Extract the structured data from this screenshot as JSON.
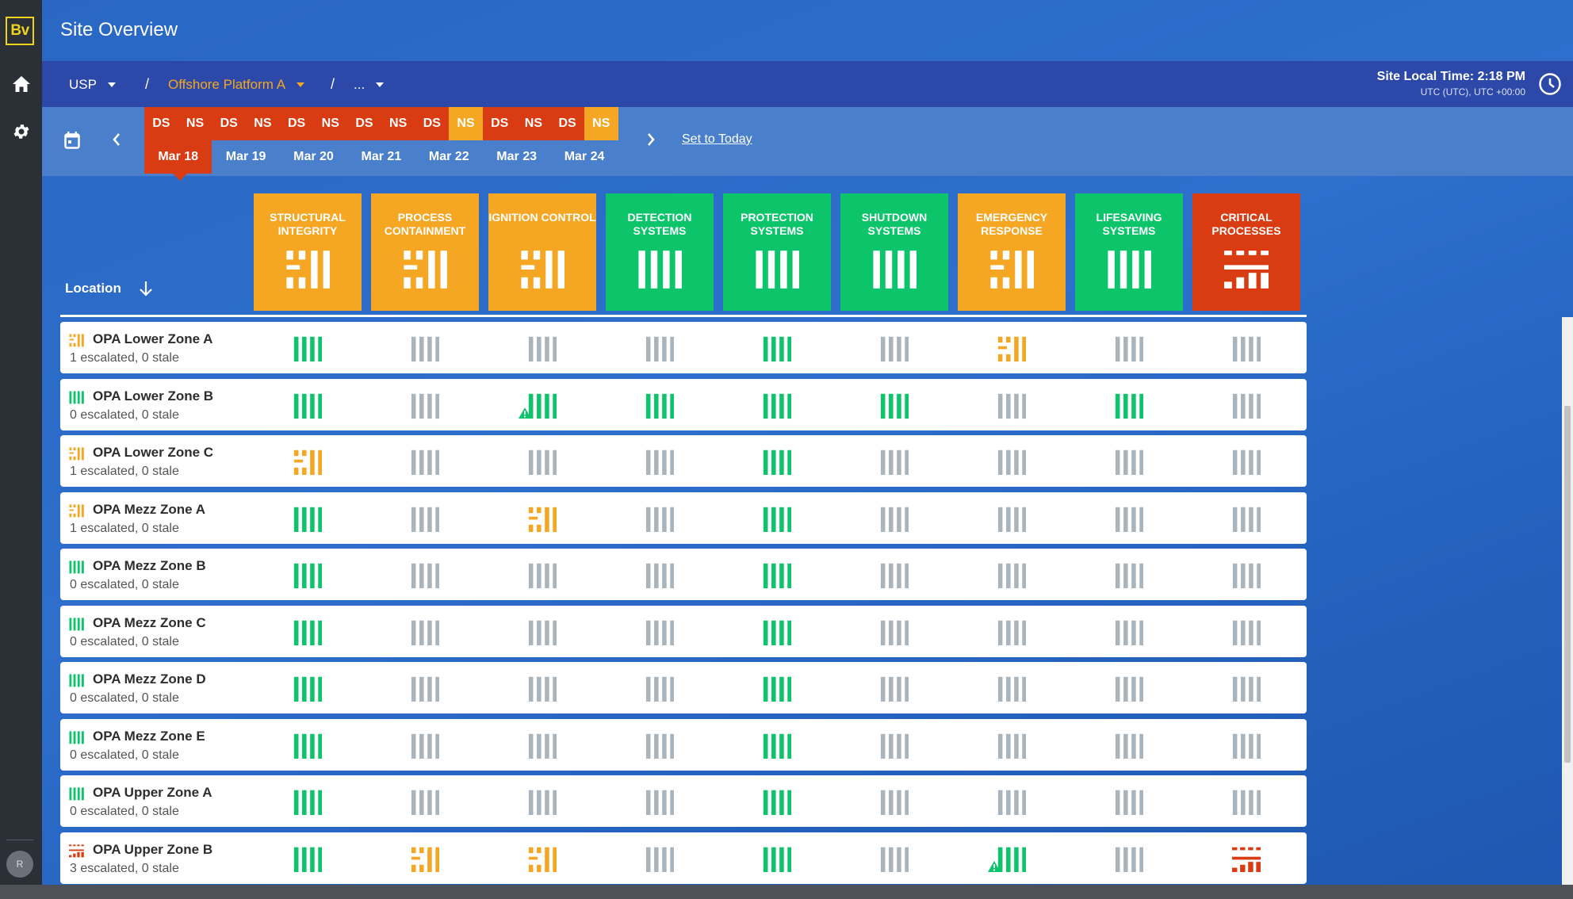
{
  "app": {
    "logo": "Bv",
    "title": "Site Overview",
    "user_initial": "R"
  },
  "breadcrumb": {
    "root": "USP",
    "site": "Offshore Platform A",
    "more": "..."
  },
  "site_time": {
    "label": "Site Local Time: 2:18 PM",
    "zone": "UTC (UTC), UTC +00:00"
  },
  "shifts": [
    {
      "label": "DS",
      "color": "red"
    },
    {
      "label": "NS",
      "color": "red"
    },
    {
      "label": "DS",
      "color": "red"
    },
    {
      "label": "NS",
      "color": "red"
    },
    {
      "label": "DS",
      "color": "red"
    },
    {
      "label": "NS",
      "color": "red"
    },
    {
      "label": "DS",
      "color": "red"
    },
    {
      "label": "NS",
      "color": "red"
    },
    {
      "label": "DS",
      "color": "red"
    },
    {
      "label": "NS",
      "color": "orange"
    },
    {
      "label": "DS",
      "color": "red"
    },
    {
      "label": "NS",
      "color": "red"
    },
    {
      "label": "DS",
      "color": "red"
    },
    {
      "label": "NS",
      "color": "orange"
    }
  ],
  "days": [
    "Mar 18",
    "Mar 19",
    "Mar 20",
    "Mar 21",
    "Mar 22",
    "Mar 23",
    "Mar 24"
  ],
  "selected_day": 0,
  "set_today": "Set to Today",
  "location_header": "Location",
  "colors": {
    "green": "#0cc46a",
    "orange": "#f5a623",
    "red": "#d93b12",
    "grey": "#a9b4bd"
  },
  "categories": [
    {
      "label": "STRUCTURAL INTEGRITY",
      "status": "orange"
    },
    {
      "label": "PROCESS CONTAINMENT",
      "status": "orange"
    },
    {
      "label": "IGNITION CONTROL",
      "status": "orange"
    },
    {
      "label": "DETECTION SYSTEMS",
      "status": "green"
    },
    {
      "label": "PROTECTION SYSTEMS",
      "status": "green"
    },
    {
      "label": "SHUTDOWN SYSTEMS",
      "status": "green"
    },
    {
      "label": "EMERGENCY RESPONSE",
      "status": "orange"
    },
    {
      "label": "LIFESAVING SYSTEMS",
      "status": "green"
    },
    {
      "label": "CRITICAL PROCESSES",
      "status": "red"
    }
  ],
  "rows": [
    {
      "name": "OPA Lower Zone A",
      "summary": "1 escalated, 0 stale",
      "status": "orange",
      "cells": [
        "green",
        "grey",
        "grey",
        "grey",
        "green",
        "grey",
        "orange",
        "grey",
        "grey"
      ],
      "warn": []
    },
    {
      "name": "OPA Lower Zone B",
      "summary": "0 escalated, 0 stale",
      "status": "green",
      "cells": [
        "green",
        "grey",
        "green",
        "green",
        "green",
        "green",
        "grey",
        "green",
        "grey"
      ],
      "warn": [
        2
      ]
    },
    {
      "name": "OPA Lower Zone C",
      "summary": "1 escalated, 0 stale",
      "status": "orange",
      "cells": [
        "orange",
        "grey",
        "grey",
        "grey",
        "green",
        "grey",
        "grey",
        "grey",
        "grey"
      ],
      "warn": []
    },
    {
      "name": "OPA Mezz Zone A",
      "summary": "1 escalated, 0 stale",
      "status": "orange",
      "cells": [
        "green",
        "grey",
        "orange",
        "grey",
        "green",
        "grey",
        "grey",
        "grey",
        "grey"
      ],
      "warn": []
    },
    {
      "name": "OPA Mezz Zone B",
      "summary": "0 escalated, 0 stale",
      "status": "green",
      "cells": [
        "green",
        "grey",
        "grey",
        "grey",
        "green",
        "grey",
        "grey",
        "grey",
        "grey"
      ],
      "warn": []
    },
    {
      "name": "OPA Mezz Zone C",
      "summary": "0 escalated, 0 stale",
      "status": "green",
      "cells": [
        "green",
        "grey",
        "grey",
        "grey",
        "green",
        "grey",
        "grey",
        "grey",
        "grey"
      ],
      "warn": []
    },
    {
      "name": "OPA Mezz Zone D",
      "summary": "0 escalated, 0 stale",
      "status": "green",
      "cells": [
        "green",
        "grey",
        "grey",
        "grey",
        "green",
        "grey",
        "grey",
        "grey",
        "grey"
      ],
      "warn": []
    },
    {
      "name": "OPA Mezz Zone E",
      "summary": "0 escalated, 0 stale",
      "status": "green",
      "cells": [
        "green",
        "grey",
        "grey",
        "grey",
        "green",
        "grey",
        "grey",
        "grey",
        "grey"
      ],
      "warn": []
    },
    {
      "name": "OPA Upper Zone A",
      "summary": "0 escalated, 0 stale",
      "status": "green",
      "cells": [
        "green",
        "grey",
        "grey",
        "grey",
        "green",
        "grey",
        "grey",
        "grey",
        "grey"
      ],
      "warn": []
    },
    {
      "name": "OPA Upper Zone B",
      "summary": "3 escalated, 0 stale",
      "status": "red",
      "cells": [
        "green",
        "orange",
        "orange",
        "grey",
        "green",
        "grey",
        "green",
        "grey",
        "red"
      ],
      "warn": [
        6
      ]
    }
  ]
}
